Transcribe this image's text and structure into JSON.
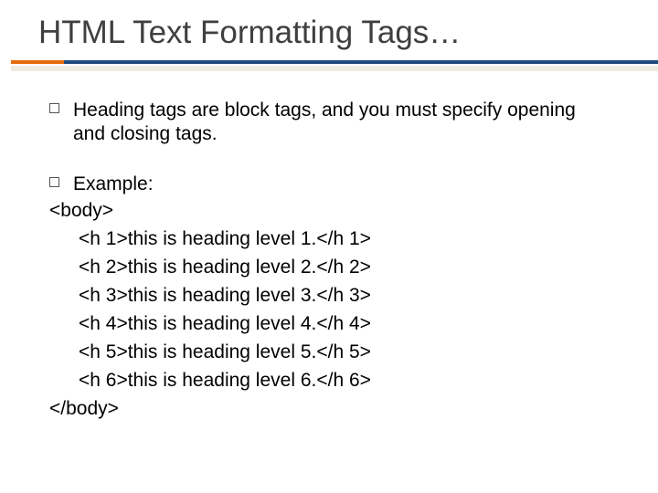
{
  "title": "HTML Text Formatting Tags…",
  "bullet1": "Heading tags are block tags, and you must specify opening and closing tags.",
  "example_label": "Example:",
  "code": {
    "open": "<body>",
    "lines": [
      "<h 1>this is heading level 1.</h 1>",
      "<h 2>this is heading level 2.</h 2>",
      "<h 3>this is heading level 3.</h 3>",
      "<h 4>this is heading level 4.</h 4>",
      "<h 5>this is heading level 5.</h 5>",
      "<h 6>this is heading level 6.</h 6>"
    ],
    "close": "</body>"
  }
}
